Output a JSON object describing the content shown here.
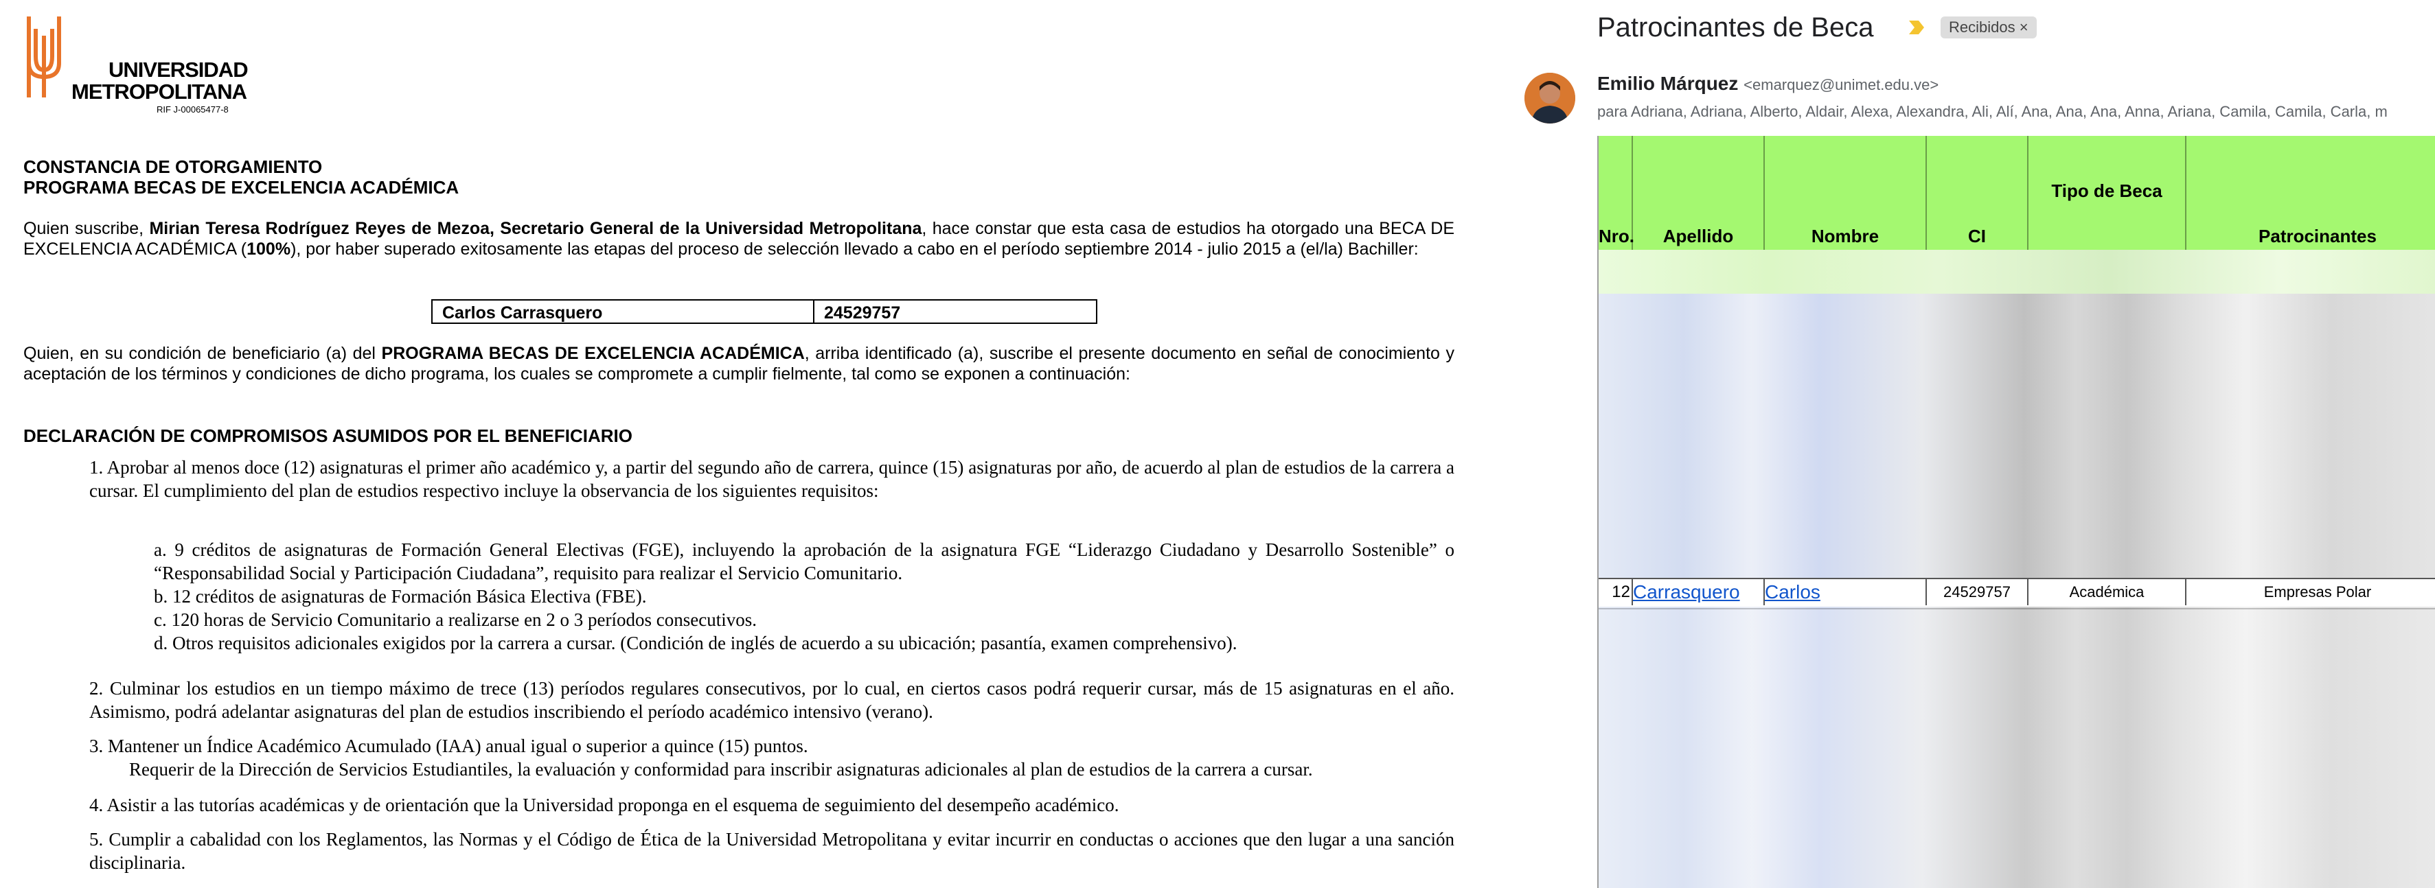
{
  "document": {
    "university_line1": "UNIVERSIDAD",
    "university_line2": "METROPOLITANA",
    "rif": "RIF J-00065477-8",
    "title1": "CONSTANCIA DE OTORGAMIENTO",
    "title2": "PROGRAMA BECAS DE EXCELENCIA ACADÉMICA",
    "intro_a": "Quien suscribe, ",
    "intro_b": "Mirian Teresa Rodríguez Reyes de Mezoa, Secretario General de la Universidad Metropolitana",
    "intro_c": ", hace constar que esta casa de estudios ha otorgado una BECA DE EXCELENCIA ACADÉMICA (",
    "intro_d": "100%",
    "intro_e": "), por haber superado exitosamente las etapas del proceso de selección llevado a cabo en el período septiembre 2014 - julio 2015 a (el/la) Bachiller:",
    "student_name": "Carlos Carrasquero",
    "student_id": "24529757",
    "cond_a": "Quien, en su condición de beneficiario (a) del ",
    "cond_b": "PROGRAMA BECAS DE EXCELENCIA ACADÉMICA",
    "cond_c": ", arriba identificado (a), suscribe el presente documento en señal de conocimiento y aceptación de los términos y condiciones de dicho programa, los cuales se compromete a cumplir fielmente, tal como se exponen a continuación:",
    "decl_heading": "DECLARACIÓN DE COMPROMISOS ASUMIDOS POR EL BENEFICIARIO",
    "item1": "1.      Aprobar al menos doce (12) asignaturas el primer año académico y, a partir del segundo año de carrera, quince (15) asignaturas por año, de acuerdo al plan de estudios de la carrera a cursar.  El cumplimiento del plan de estudios respectivo incluye la observancia de los siguientes requisitos:",
    "sub_a": "a.       9 créditos de asignaturas de Formación General Electivas (FGE), incluyendo la aprobación de la asignatura FGE “Liderazgo Ciudadano y Desarrollo Sostenible” o “Responsabilidad Social y Participación Ciudadana”, requisito para realizar el Servicio Comunitario.",
    "sub_b": "b.    12 créditos de asignaturas de Formación Básica Electiva (FBE).",
    "sub_c": "c.    120 horas de Servicio Comunitario a realizarse en 2 o 3 períodos consecutivos.",
    "sub_d": "d.    Otros requisitos adicionales exigidos por la carrera a cursar. (Condición de inglés de acuerdo a su ubicación; pasantía, examen comprehensivo).",
    "item2": "2.    Culminar los estudios en un tiempo máximo de trece (13) períodos regulares consecutivos, por lo cual, en ciertos casos podrá requerir cursar, más de 15 asignaturas en el año. Asimismo, podrá adelantar asignaturas del plan de estudios inscribiendo el período académico intensivo (verano).",
    "item3a": "3.    Mantener un Índice Académico Acumulado (IAA) anual igual o superior a quince (15) puntos.",
    "item3b": "Requerir de la Dirección de Servicios Estudiantiles, la evaluación y conformidad para inscribir asignaturas adicionales al plan de estudios de la carrera a cursar.",
    "item4": "4.    Asistir a las tutorías académicas y de orientación que la Universidad proponga en el esquema de seguimiento del desempeño académico.",
    "item5": "5.    Cumplir a cabalidad con los Reglamentos, las Normas y el Código de Ética de la Universidad Metropolitana y evitar incurrir en conductas o acciones que den lugar a una sanción disciplinaria."
  },
  "email": {
    "subject": "Patrocinantes de Beca",
    "label": "Recibidos",
    "label_close": "×",
    "sender_name": "Emilio Márquez",
    "sender_email": "<emarquez@unimet.edu.ve>",
    "recipients": "para Adriana, Adriana, Alberto, Aldair, Alexa, Alexandra, Ali, Alí, Ana, Ana, Ana, Anna, Ariana, Camila, Camila, Carla, m",
    "table_headers": [
      "Nro.",
      "Apellido",
      "Nombre",
      "CI",
      "Tipo de Beca",
      "Patrocinantes"
    ],
    "row": {
      "nro": "12",
      "apellido": "Carrasquero",
      "nombre": "Carlos",
      "ci": "24529757",
      "tipo": "Académica",
      "patrocinante": "Empresas Polar"
    }
  },
  "colors": {
    "logo_orange": "#e8742a",
    "header_green": "#a4f870",
    "link_blue": "#1155cc",
    "importance_yellow": "#f4c430"
  }
}
